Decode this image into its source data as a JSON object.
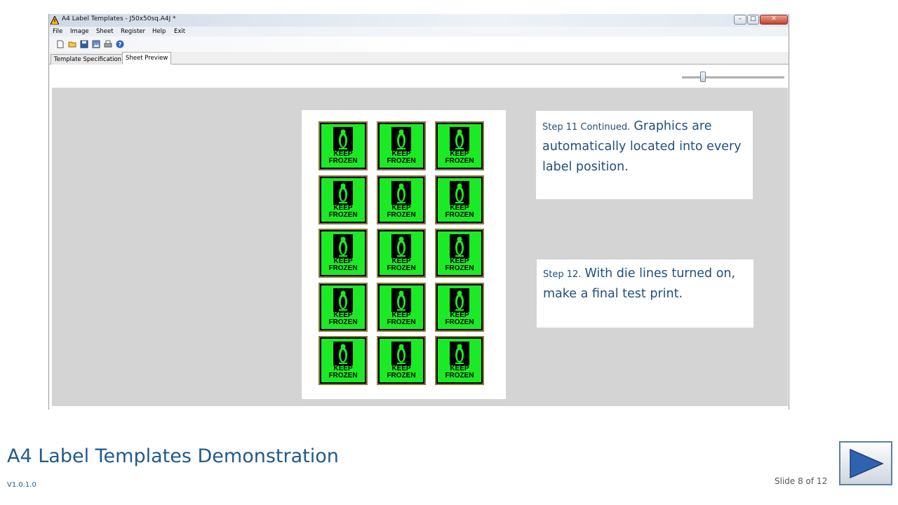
{
  "window": {
    "title": "A4 Label Templates - J50x50sq.A4J *",
    "minimize": "–",
    "maximize": "□",
    "close": "✕"
  },
  "menu": [
    "File",
    "Image",
    "Sheet",
    "Register",
    "Help",
    "Exit"
  ],
  "toolbar_icons": [
    "new-icon",
    "open-icon",
    "save-icon",
    "image-icon",
    "print-icon",
    "help-icon"
  ],
  "tabs": [
    {
      "label": "Template Specification",
      "active": false
    },
    {
      "label": "Sheet Preview",
      "active": true
    }
  ],
  "zoom_slider": {
    "level": 0.19
  },
  "sheet": {
    "columns": 3,
    "rows": 5,
    "label_line1": "KEEP",
    "label_line2": "FROZEN",
    "label_color": "#1aeb24"
  },
  "notes": [
    {
      "step": "Step 11 Continued.",
      "text": "Graphics are automatically located into every label position."
    },
    {
      "step": "Step 12.",
      "text": "With die lines turned on, make a final test print."
    }
  ],
  "footer": {
    "title": "A4 Label Templates Demonstration",
    "version": "V1.0.1.0",
    "slide": "Slide 8 of 12"
  },
  "colors": {
    "accent": "#1f5a8c",
    "note_text": "#1f4f80",
    "preview_bg": "#d4d4d4"
  }
}
